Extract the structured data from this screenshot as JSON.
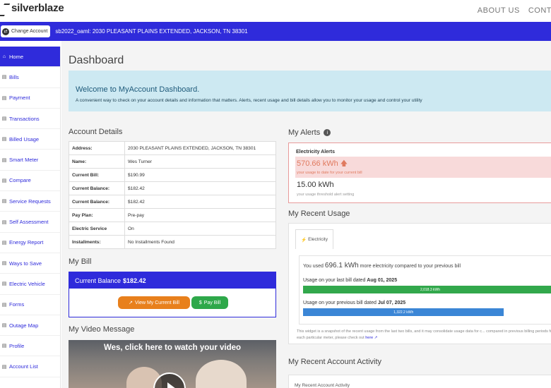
{
  "brand": {
    "name": "silverblaze"
  },
  "topnav": {
    "about": "ABOUT US",
    "contact": "CONTA"
  },
  "account_bar": {
    "change_label": "Change Account",
    "account_text": "sb2022_oaml: 2030 PLEASANT PLAINS EXTENDED, JACKSON, TN 38301"
  },
  "sidebar": {
    "items": [
      {
        "label": "Home",
        "icon": "home-icon",
        "glyph": "⌂"
      },
      {
        "label": "Bills",
        "icon": "bills-icon",
        "glyph": "▤"
      },
      {
        "label": "Payment",
        "icon": "payment-icon",
        "glyph": "▤"
      },
      {
        "label": "Transactions",
        "icon": "transactions-icon",
        "glyph": "▤"
      },
      {
        "label": "Billed Usage",
        "icon": "billed-usage-icon",
        "glyph": "▤"
      },
      {
        "label": "Smart Meter",
        "icon": "smart-meter-icon",
        "glyph": "▤"
      },
      {
        "label": "Compare",
        "icon": "compare-icon",
        "glyph": "▤"
      },
      {
        "label": "Service Requests",
        "icon": "service-requests-icon",
        "glyph": "▤"
      },
      {
        "label": "Self Assessment",
        "icon": "self-assessment-icon",
        "glyph": "▤"
      },
      {
        "label": "Energy Report",
        "icon": "energy-report-icon",
        "glyph": "▤"
      },
      {
        "label": "Ways to Save",
        "icon": "ways-to-save-icon",
        "glyph": "▤"
      },
      {
        "label": "Electric Vehicle",
        "icon": "electric-vehicle-icon",
        "glyph": "▤"
      },
      {
        "label": "Forms",
        "icon": "forms-icon",
        "glyph": "▤"
      },
      {
        "label": "Outage Map",
        "icon": "outage-map-icon",
        "glyph": "▤"
      },
      {
        "label": "Profile",
        "icon": "profile-icon",
        "glyph": "▤"
      },
      {
        "label": "Account List",
        "icon": "account-list-icon",
        "glyph": "▤"
      }
    ]
  },
  "dashboard": {
    "title": "Dashboard",
    "welcome_title": "Welcome to MyAccount Dashboard.",
    "welcome_text": "A convenient way to check on your account details and information that matters. Alerts, recent usage and bill details allow you to monitor your usage and control your utility"
  },
  "account_details": {
    "title": "Account Details",
    "rows": [
      {
        "label": "Address:",
        "value": "2030 PLEASANT PLAINS EXTENDED, JACKSON, TN 38301"
      },
      {
        "label": "Name:",
        "value": "Wes Turner"
      },
      {
        "label": "Current Bill:",
        "value": "$190.99"
      },
      {
        "label": "Current Balance:",
        "value": "$182.42"
      },
      {
        "label": "Current Balance:",
        "value": "$182.42"
      },
      {
        "label": "Pay Plan:",
        "value": "Pre-pay"
      },
      {
        "label": "Electric Service",
        "value": "On"
      },
      {
        "label": "Installments:",
        "value": "No Installments Found"
      }
    ]
  },
  "my_bill": {
    "title": "My Bill",
    "balance_label": "Current Balance",
    "balance_value": "$182.42",
    "view_button": "View My Current Bill",
    "pay_button": "Pay Bill"
  },
  "video": {
    "title": "My Video Message",
    "caption": "Wes, click here to watch your video"
  },
  "alerts": {
    "title": "My Alerts",
    "heading": "Electricity Alerts",
    "usage_value": "570.66 kWh",
    "usage_sub": "your usage to date for your current bill",
    "threshold_value": "15.00 kWh",
    "threshold_sub": "your usage threshold alert setting"
  },
  "recent_usage": {
    "title": "My Recent Usage",
    "tab": "Electricity",
    "used_prefix": "You used",
    "used_value": "696.1 kWh",
    "used_suffix": "more electricity compared to your previous bill",
    "last_bill_label": "Usage on your last bill dated",
    "last_bill_date": "Aug 01, 2025",
    "last_bill_value": "2,018.3 kWh",
    "prev_bill_label": "Usage on your previous bill dated",
    "prev_bill_date": "Jul 07, 2025",
    "prev_bill_value": "1,322.2 kWh",
    "last_bill_fill": 1.0,
    "prev_bill_fill": 0.79,
    "note": "This widget is a snapshot of the recent usage from the last two bills, and it may consolidate usage data for c... compared in previous billing periods for each particular meter, please check out",
    "note_link": "here"
  },
  "recent_activity": {
    "title": "My Recent Account Activity",
    "sub": "My Recent Account Activity"
  }
}
